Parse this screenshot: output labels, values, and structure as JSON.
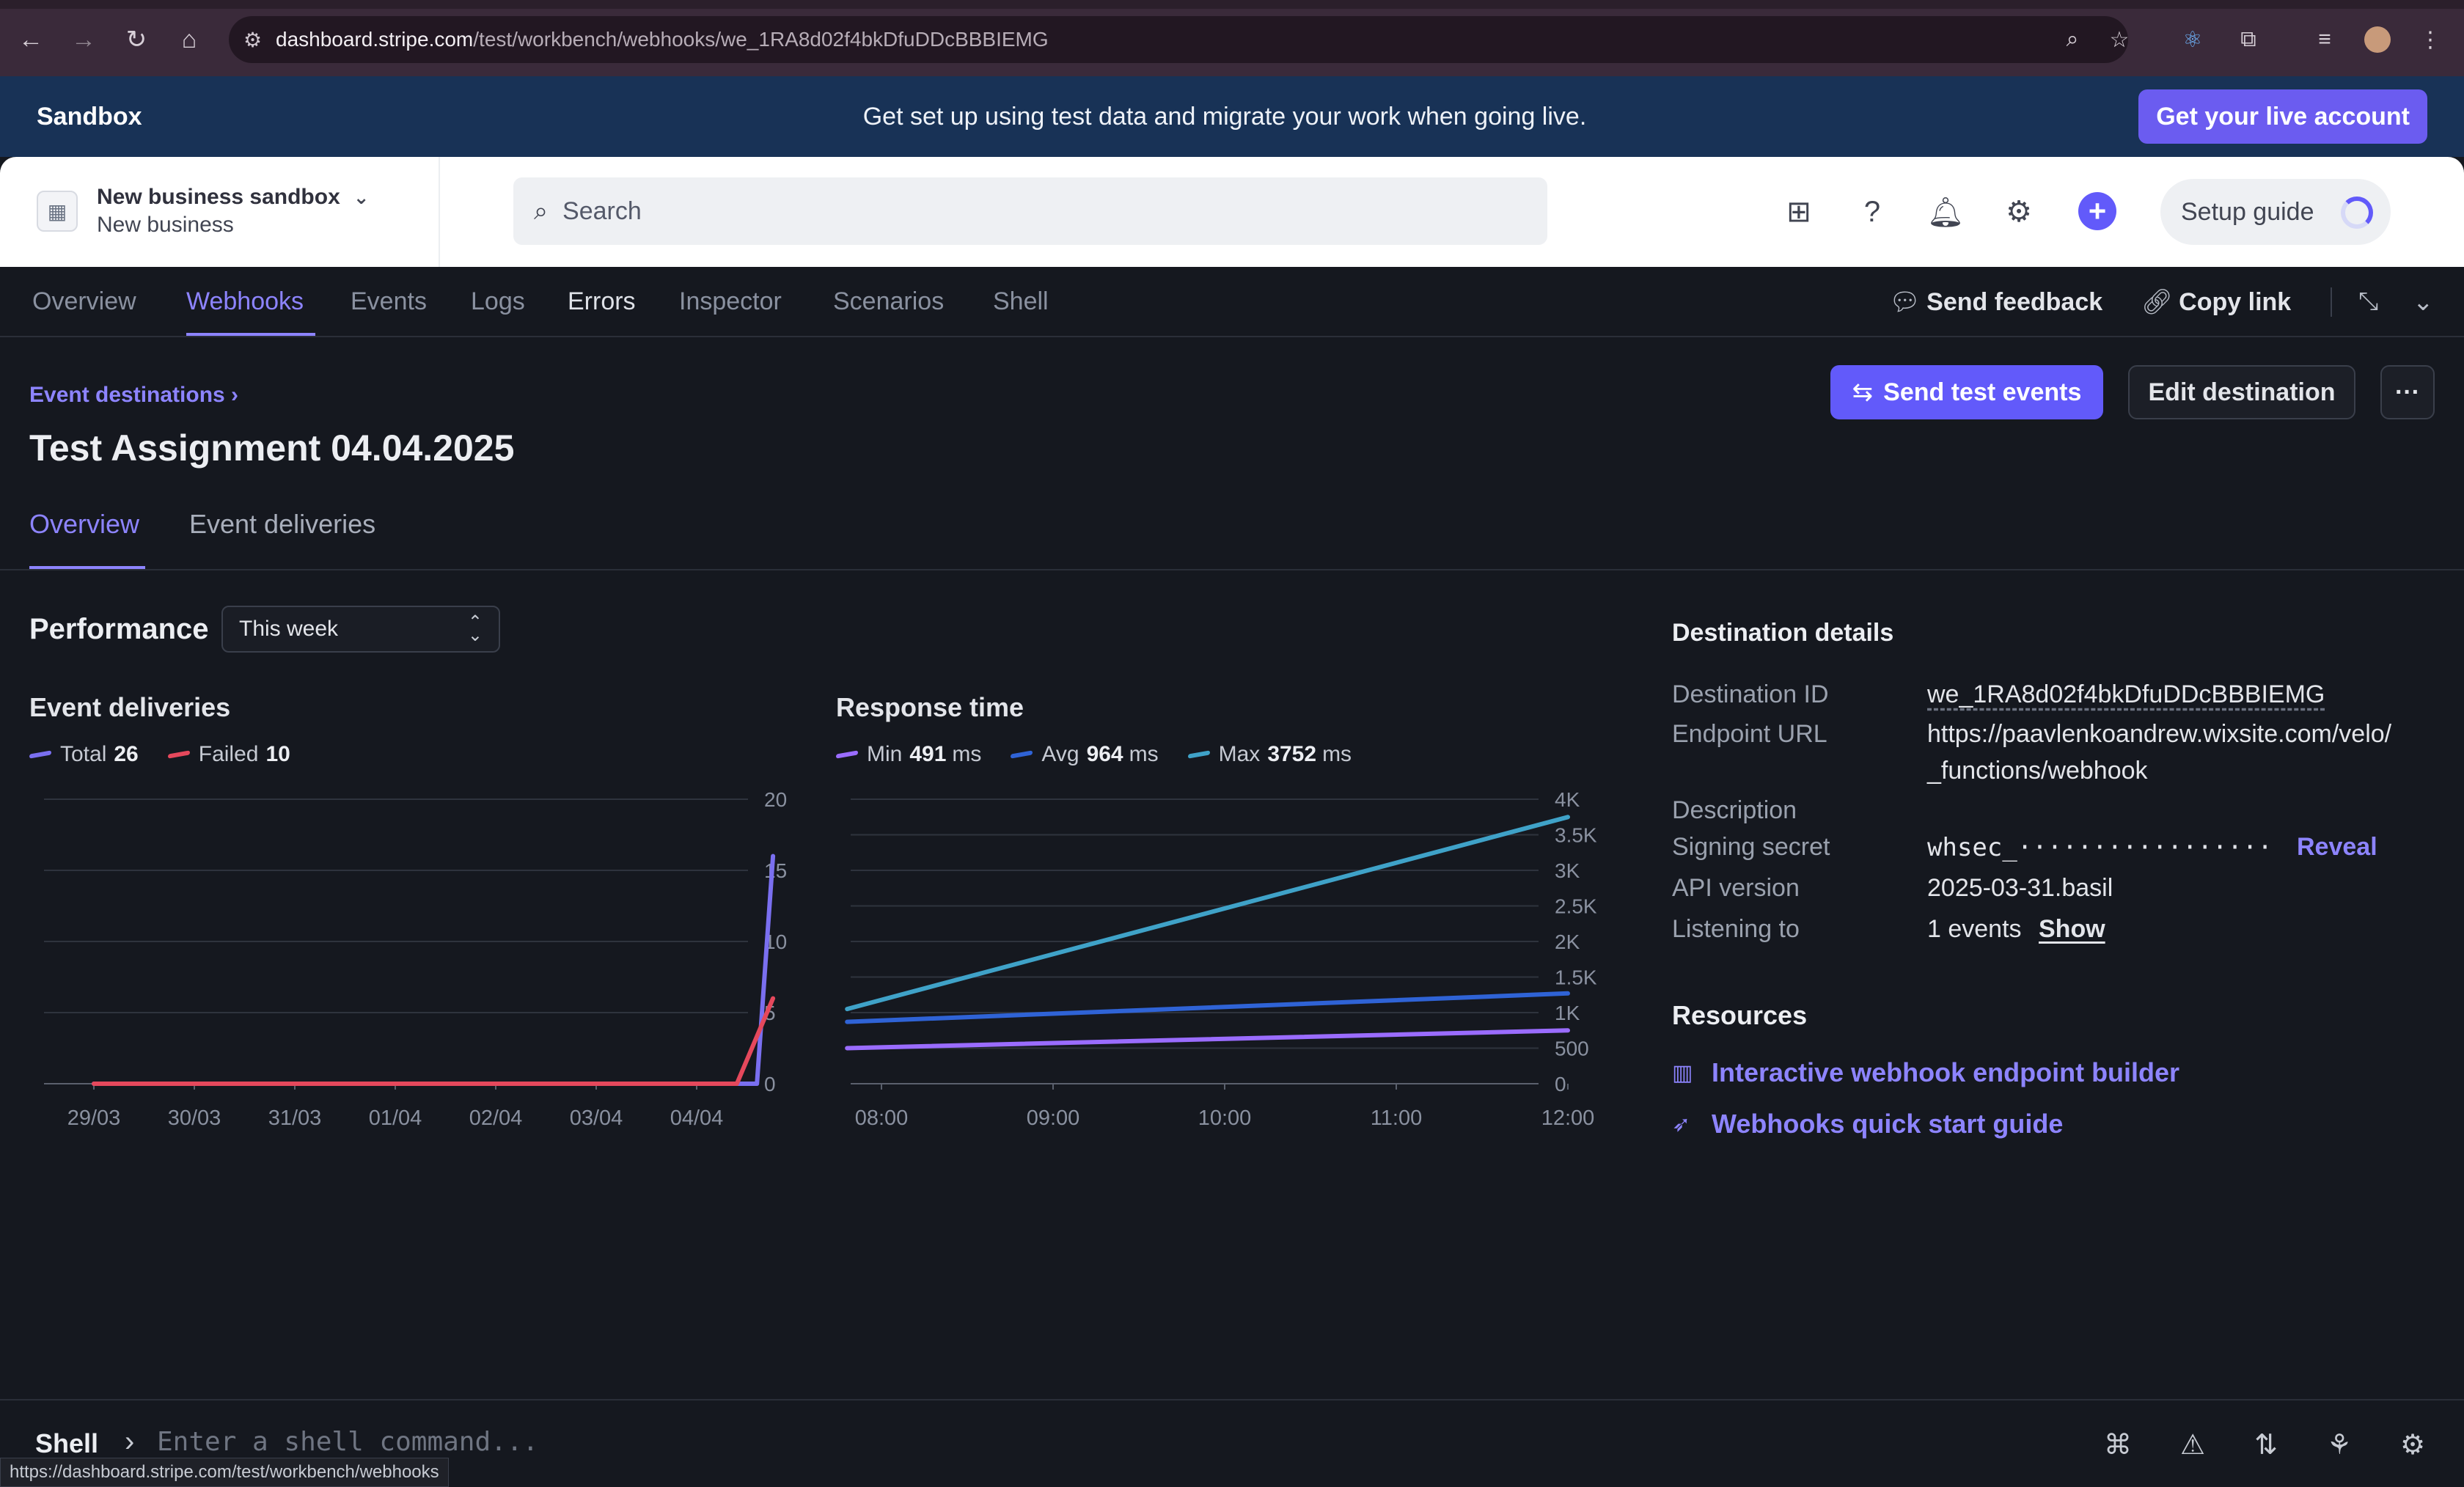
{
  "browser": {
    "url_host": "dashboard.stripe.com",
    "url_path": "/test/workbench/webhooks/we_1RA8d02f4bkDfuDDcBBBIEMG",
    "status_url": "https://dashboard.stripe.com/test/workbench/webhooks"
  },
  "banner": {
    "label": "Sandbox",
    "message": "Get set up using test data and migrate your work when going live.",
    "cta": "Get your live account"
  },
  "account": {
    "name": "New business sandbox",
    "subtitle": "New business"
  },
  "search": {
    "placeholder": "Search"
  },
  "setup_guide": "Setup guide",
  "workbench": {
    "tabs": [
      {
        "label": "Overview"
      },
      {
        "label": "Webhooks"
      },
      {
        "label": "Events"
      },
      {
        "label": "Logs"
      },
      {
        "label": "Errors"
      },
      {
        "label": "Inspector"
      },
      {
        "label": "Scenarios"
      },
      {
        "label": "Shell"
      }
    ],
    "active_tab": "Webhooks",
    "send_feedback": "Send feedback",
    "copy_link": "Copy link"
  },
  "page": {
    "breadcrumb": "Event destinations",
    "title": "Test Assignment 04.04.2025",
    "send_test_events": "Send test events",
    "edit_destination": "Edit destination",
    "more": "···",
    "subtabs": [
      {
        "label": "Overview"
      },
      {
        "label": "Event deliveries"
      }
    ]
  },
  "performance": {
    "title": "Performance",
    "range": "This week"
  },
  "chart_data": [
    {
      "type": "line",
      "title": "Event deliveries",
      "categories": [
        "29/03",
        "30/03",
        "31/03",
        "01/04",
        "02/04",
        "03/04",
        "04/04"
      ],
      "ylim": [
        0,
        20
      ],
      "yticks": [
        "0",
        "5",
        "10",
        "15",
        "20"
      ],
      "legend": [
        {
          "name": "Total",
          "value": "26",
          "color": "#7a6ff0"
        },
        {
          "name": "Failed",
          "value": "10",
          "color": "#e5485c"
        }
      ],
      "series": [
        {
          "name": "Total",
          "x": [
            0,
            6.6,
            6.76
          ],
          "values": [
            0,
            0,
            16
          ]
        },
        {
          "name": "Failed",
          "x": [
            0,
            6.4,
            6.76
          ],
          "values": [
            0,
            0,
            6
          ]
        }
      ]
    },
    {
      "type": "line",
      "title": "Response time",
      "categories": [
        "08:00",
        "09:00",
        "10:00",
        "11:00",
        "12:00"
      ],
      "ylim": [
        0,
        4000
      ],
      "yticks": [
        "0",
        "500",
        "1K",
        "1.5K",
        "2K",
        "2.5K",
        "3K",
        "3.5K",
        "4K"
      ],
      "legend": [
        {
          "name": "Min",
          "value": "491",
          "unit": "ms",
          "color": "#9a6cff"
        },
        {
          "name": "Avg",
          "value": "964",
          "unit": "ms",
          "color": "#2f63d6"
        },
        {
          "name": "Max",
          "value": "3752",
          "unit": "ms",
          "color": "#3fa2c8"
        }
      ],
      "series": [
        {
          "name": "Min",
          "x": [
            -0.2,
            4
          ],
          "values": [
            500,
            750
          ]
        },
        {
          "name": "Avg",
          "x": [
            -0.2,
            4
          ],
          "values": [
            870,
            1270
          ]
        },
        {
          "name": "Max",
          "x": [
            -0.2,
            4
          ],
          "values": [
            1050,
            3750
          ]
        }
      ]
    }
  ],
  "destination": {
    "title": "Destination details",
    "rows": [
      {
        "key": "Destination ID",
        "value": "we_1RA8d02f4bkDfuDDcBBBIEMG"
      },
      {
        "key": "Endpoint URL",
        "value": "https://paavlenkoandrew.wixsite.com/velo/",
        "value2": "_functions/webhook"
      },
      {
        "key": "Description",
        "value": ""
      },
      {
        "key": "Signing secret",
        "value": "whsec_·················"
      },
      {
        "key": "API version",
        "value": "2025-03-31.basil"
      },
      {
        "key": "Listening to",
        "value": "1 events"
      }
    ],
    "reveal": "Reveal",
    "show": "Show"
  },
  "resources": {
    "title": "Resources",
    "links": [
      {
        "label": "Interactive webhook endpoint builder",
        "icon": "book-icon"
      },
      {
        "label": "Webhooks quick start guide",
        "icon": "rocket-icon"
      }
    ]
  },
  "shell": {
    "label": "Shell",
    "placeholder": "Enter a shell command..."
  }
}
